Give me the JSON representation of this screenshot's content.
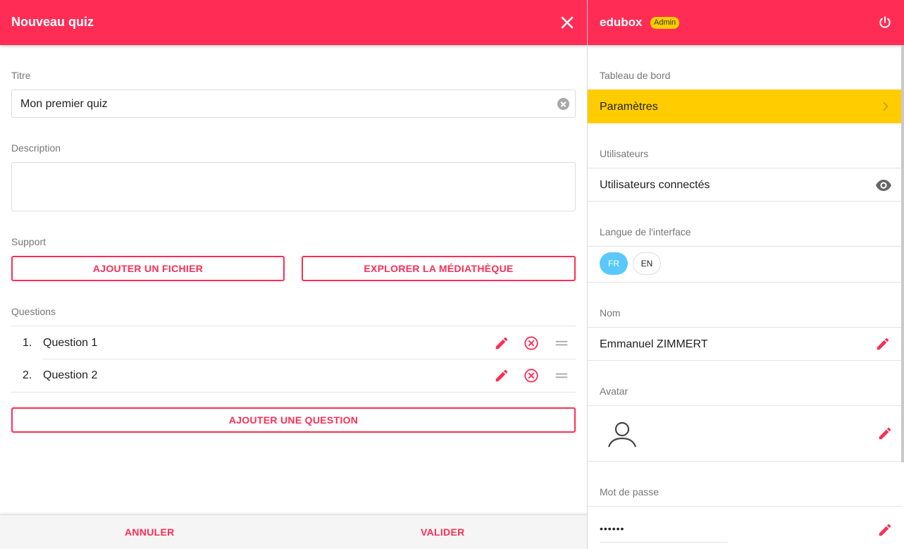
{
  "quiz": {
    "title": "Nouveau quiz",
    "title_label": "Titre",
    "title_value": "Mon premier quiz",
    "description_label": "Description",
    "description_value": "",
    "support_label": "Support",
    "add_file_label": "AJOUTER UN FICHIER",
    "explore_media_label": "EXPLORER LA MÉDIATHÈQUE",
    "questions_label": "Questions",
    "questions": [
      {
        "number": "1.",
        "text": "Question 1"
      },
      {
        "number": "2.",
        "text": "Question 2"
      }
    ],
    "add_question_label": "AJOUTER UNE QUESTION",
    "cancel_label": "ANNULER",
    "validate_label": "VALIDER"
  },
  "sidebar": {
    "brand": "edubox",
    "badge": "Admin",
    "dashboard_label": "Tableau de bord",
    "settings_label": "Paramètres",
    "users_label": "Utilisateurs",
    "connected_users_label": "Utilisateurs connectés",
    "language_label": "Langue de l'interface",
    "lang_fr": "FR",
    "lang_en": "EN",
    "selected_language": "FR",
    "name_label": "Nom",
    "name_value": "Emmanuel ZIMMERT",
    "avatar_label": "Avatar",
    "password_label": "Mot de passe",
    "password_value": "••••••"
  },
  "colors": {
    "primary": "#ff2d55",
    "accent_yellow": "#ffcc00",
    "lang_selected": "#5ac8fa"
  },
  "icons": [
    "close-icon",
    "clear-icon",
    "edit-icon",
    "delete-icon",
    "drag-handle-icon",
    "power-icon",
    "chevron-right-icon",
    "eye-icon",
    "user-avatar-icon"
  ]
}
